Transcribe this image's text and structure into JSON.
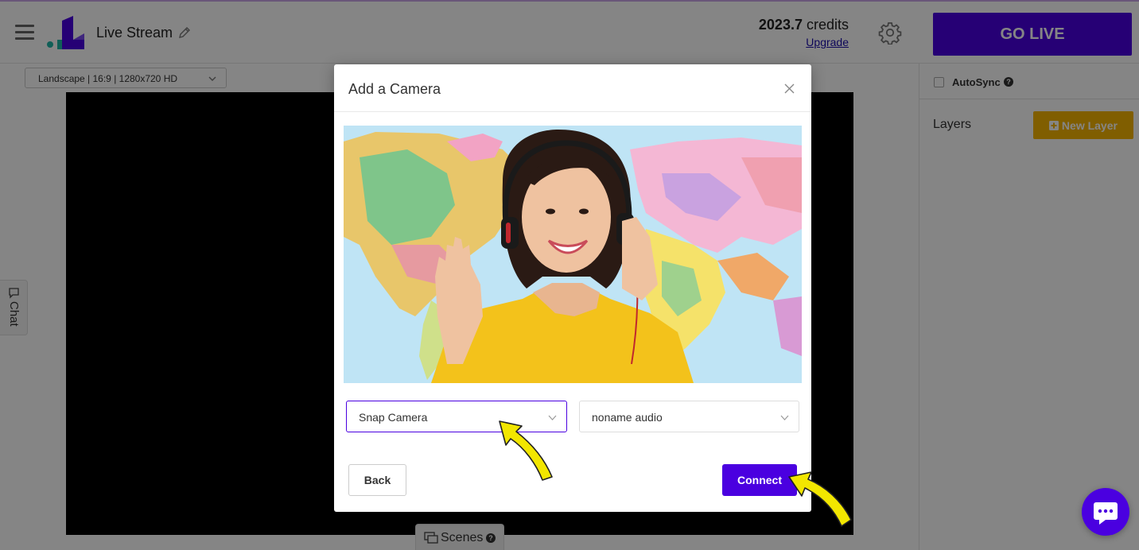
{
  "header": {
    "title": "Live Stream",
    "credits_value": "2023.7",
    "credits_unit": "credits",
    "upgrade_label": "Upgrade",
    "go_live_label": "GO LIVE"
  },
  "toolbar": {
    "layout_selected": "Landscape | 16:9 | 1280x720 HD"
  },
  "right_panel": {
    "autosync_label": "AutoSync",
    "layers_title": "Layers",
    "new_layer_label": "New Layer"
  },
  "side": {
    "chat_label": "Chat",
    "scenes_label": "Scenes"
  },
  "modal": {
    "title": "Add a Camera",
    "camera_selected": "Snap Camera",
    "audio_selected": "noname audio",
    "back_label": "Back",
    "connect_label": "Connect"
  },
  "colors": {
    "accent": "#4a00e0",
    "new_layer": "#f5b400",
    "annotation_arrow": "#f2e600"
  },
  "icons": [
    "menu-icon",
    "logo-icon",
    "pencil-icon",
    "gear-icon",
    "chevron-down-icon",
    "help-icon",
    "plus-square-icon",
    "chat-icon",
    "scenes-icon",
    "close-icon",
    "chat-bubble-icon"
  ]
}
